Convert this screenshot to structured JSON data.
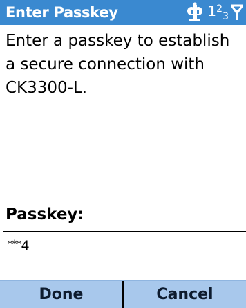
{
  "titlebar": {
    "title": "Enter Passkey",
    "icons": [
      "bluetooth-connection-icon",
      "input-mode-123",
      "signal-strength-icon"
    ],
    "input_mode": {
      "main": "1",
      "sup": "2",
      "sub": "3"
    },
    "background_color": "#3a89d0"
  },
  "dialog": {
    "message": "Enter a passkey to establish a secure connection with CK3300-L.",
    "field_label": "Passkey:",
    "passkey": {
      "mask": "***",
      "last_char": "4"
    }
  },
  "softkeys": {
    "left_label": "Done",
    "right_label": "Cancel",
    "background_color": "#a8c8ec"
  }
}
